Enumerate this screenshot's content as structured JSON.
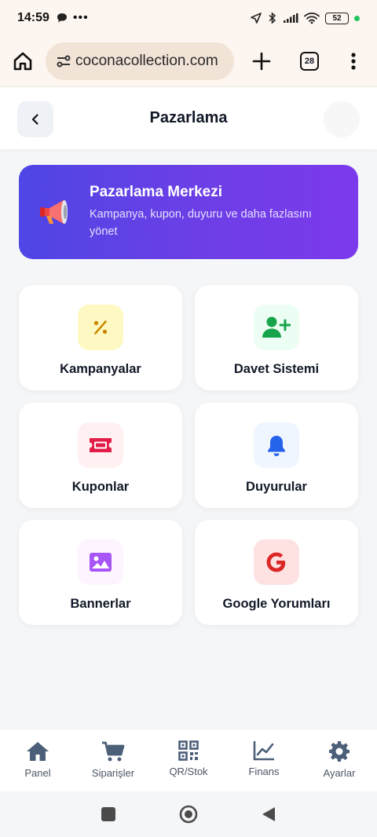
{
  "status_bar": {
    "time": "14:59",
    "battery": "52"
  },
  "browser": {
    "url": "coconacollection.com",
    "tab_count": "28"
  },
  "header": {
    "title": "Pazarlama"
  },
  "hero": {
    "title": "Pazarlama Merkezi",
    "subtitle": "Kampanya, kupon, duyuru ve daha fazlasını yönet"
  },
  "cards": [
    {
      "label": "Kampanyalar",
      "icon": "percent-icon",
      "color": "#ca8a04",
      "bg": "#fef9c3"
    },
    {
      "label": "Davet Sistemi",
      "icon": "user-plus-icon",
      "color": "#16a34a",
      "bg": "#ecfdf3"
    },
    {
      "label": "Kuponlar",
      "icon": "ticket-icon",
      "color": "#e11d48",
      "bg": "#fff1f2"
    },
    {
      "label": "Duyurular",
      "icon": "bell-icon",
      "color": "#2563eb",
      "bg": "#eff6ff"
    },
    {
      "label": "Bannerlar",
      "icon": "image-icon",
      "color": "#a855f7",
      "bg": "#fdf4ff"
    },
    {
      "label": "Google Yorumları",
      "icon": "google-icon",
      "color": "#dc2626",
      "bg": "#fee2e2"
    }
  ],
  "bottom_nav": [
    {
      "label": "Panel",
      "icon": "home-icon"
    },
    {
      "label": "Siparişler",
      "icon": "cart-icon"
    },
    {
      "label": "QR/Stok",
      "icon": "qr-icon"
    },
    {
      "label": "Finans",
      "icon": "chart-icon"
    },
    {
      "label": "Ayarlar",
      "icon": "gear-icon"
    }
  ]
}
